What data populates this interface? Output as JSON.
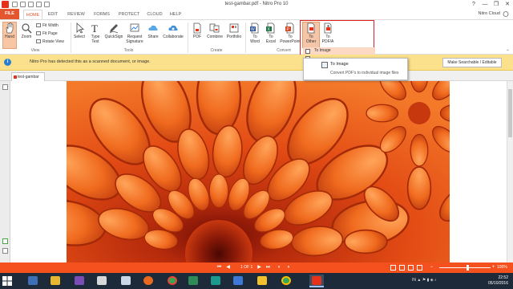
{
  "window": {
    "title": "test-gambar.pdf - Nitro Pro 10",
    "controls": [
      "?",
      "—",
      "❐",
      "✕"
    ]
  },
  "tabs": [
    {
      "label": "FILE"
    },
    {
      "label": "HOME"
    },
    {
      "label": "EDIT"
    },
    {
      "label": "REVIEW"
    },
    {
      "label": "FORMS"
    },
    {
      "label": "PROTECT"
    },
    {
      "label": "CLOUD"
    },
    {
      "label": "HELP"
    }
  ],
  "user": "Nitro Cloud",
  "ribbon": {
    "view": {
      "hand": "Hand",
      "zoom": "Zoom",
      "fit_width": "Fit Width",
      "fit_page": "Fit Page",
      "rotate_view": "Rotate View",
      "group": "View"
    },
    "tools": {
      "select": "Select",
      "type_text": [
        "Type",
        "Text"
      ],
      "quicksign": [
        "QuickSign"
      ],
      "request_signature": [
        "Request",
        "Signature"
      ],
      "share": "Share",
      "collaborate": "Collaborate",
      "group": "Tools"
    },
    "create": {
      "pdf": "PDF",
      "combine": "Combine",
      "portfolio": "Portfolio",
      "group": "Create"
    },
    "convert": {
      "to_word": [
        "To",
        "Word"
      ],
      "to_excel": [
        "To",
        "Excel"
      ],
      "to_powerpoint": [
        "To",
        "PowerPoint"
      ],
      "to_other": [
        "To",
        "Other"
      ],
      "to_pdfa": [
        "To",
        "PDF/A"
      ],
      "group": "Convert"
    }
  },
  "notice": {
    "text": "Nitro Pro has detected this as a scanned document, or image.",
    "button": "Make Searchable / Editable"
  },
  "document_tab": "test-gambar",
  "submenu": {
    "items": [
      "To Image",
      "",
      "",
      ""
    ]
  },
  "dropdown": {
    "title": "To Image",
    "description": "Convert PDF's to individual image files"
  },
  "status": {
    "page": "1 OF 1",
    "zoom": "100%"
  },
  "tray": {
    "lang": "IN",
    "time": "22:52",
    "date": "05/10/2016"
  },
  "colors": {
    "accent": "#f4511e",
    "file_tab": "#e4572e",
    "notice_bg": "#fbe18b",
    "highlight_box": "#dd2222"
  }
}
